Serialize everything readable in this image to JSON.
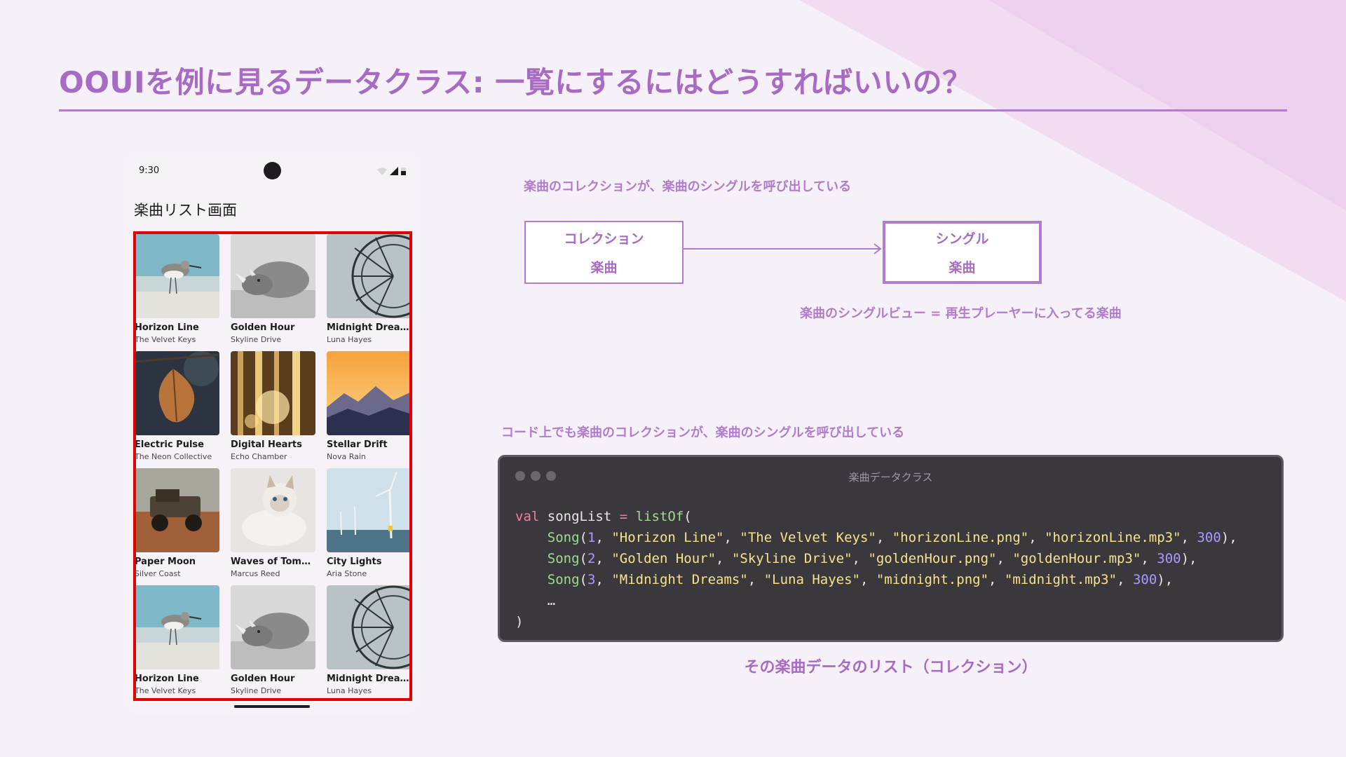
{
  "slide": {
    "title": "OOUIを例に見るデータクラス: 一覧にするにはどうすればいいの？"
  },
  "phone": {
    "time": "9:30",
    "screen_title": "楽曲リスト画面",
    "songs": [
      {
        "title": "Horizon Line",
        "artist": "The Velvet Keys",
        "image": "sandpiper-beach"
      },
      {
        "title": "Golden Hour",
        "artist": "Skyline Drive",
        "image": "rhino-bw"
      },
      {
        "title": "Midnight Dreams",
        "artist": "Luna Hayes",
        "image": "ferris-wheel"
      },
      {
        "title": "Electric Pulse",
        "artist": "The Neon Collective",
        "image": "autumn-leaf"
      },
      {
        "title": "Digital Hearts",
        "artist": "Echo Chamber",
        "image": "golden-forest"
      },
      {
        "title": "Stellar Drift",
        "artist": "Nova Rain",
        "image": "mountain-sunset"
      },
      {
        "title": "Paper Moon",
        "artist": "Silver Coast",
        "image": "vintage-truck"
      },
      {
        "title": "Waves of Tomorrow",
        "artist": "Marcus Reed",
        "image": "cat"
      },
      {
        "title": "City Lights",
        "artist": "Aria Stone",
        "image": "wind-turbines"
      },
      {
        "title": "Horizon Line",
        "artist": "The Velvet Keys",
        "image": "sandpiper-beach"
      },
      {
        "title": "Golden Hour",
        "artist": "Skyline Drive",
        "image": "rhino-bw"
      },
      {
        "title": "Midnight Dreams",
        "artist": "Luna Hayes",
        "image": "ferris-wheel"
      }
    ]
  },
  "diagram": {
    "top_note": "楽曲のコレクションが、楽曲のシングルを呼び出している",
    "collection_box": {
      "line1": "コレクション",
      "line2": "楽曲"
    },
    "single_box": {
      "line1": "シングル",
      "line2": "楽曲"
    },
    "single_note": "楽曲のシングルビュー = 再生プレーヤーに入ってる楽曲",
    "code_note": "コード上でも楽曲のコレクションが、楽曲のシングルを呼び出している"
  },
  "code_window": {
    "caption": "楽曲データクラス",
    "keyword": "val",
    "variable": "songList",
    "list_fn": "listOf",
    "ctor": "Song",
    "rows": [
      {
        "id": "1",
        "title": "\"Horizon Line\"",
        "artist": "\"The Velvet Keys\"",
        "image": "\"horizonLine.png\"",
        "audio": "\"horizonLine.mp3\"",
        "duration": "300"
      },
      {
        "id": "2",
        "title": "\"Golden Hour\"",
        "artist": "\"Skyline Drive\"",
        "image": "\"goldenHour.png\"",
        "audio": "\"goldenHour.mp3\"",
        "duration": "300"
      },
      {
        "id": "3",
        "title": "\"Midnight Dreams\"",
        "artist": "\"Luna Hayes\"",
        "image": "\"midnight.png\"",
        "audio": "\"midnight.mp3\"",
        "duration": "300"
      }
    ],
    "ellipsis": "…"
  },
  "bottom_caption": "その楽曲データのリスト（コレクション）",
  "colors": {
    "accent": "#a86bc3",
    "highlight_frame": "#e50000",
    "code_bg": "#3a383c"
  }
}
